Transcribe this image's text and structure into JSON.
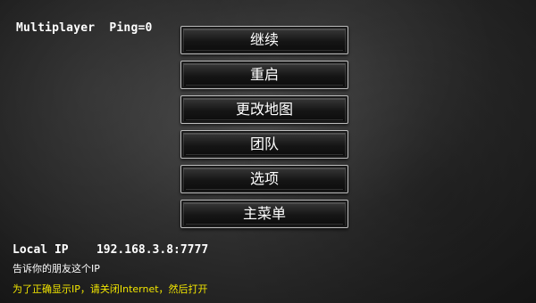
{
  "status": {
    "mode": "Multiplayer",
    "ping": "Ping=0"
  },
  "menu": {
    "items": [
      {
        "label": "继续"
      },
      {
        "label": "重启"
      },
      {
        "label": "更改地图"
      },
      {
        "label": "团队"
      },
      {
        "label": "选项"
      },
      {
        "label": "主菜单"
      }
    ]
  },
  "network": {
    "local_ip_label": "Local IP",
    "local_ip_value": "192.168.3.8:7777",
    "share_hint": "告诉你的朋友这个IP",
    "warning": "为了正确显示IP，请关闭Internet，然后打开"
  },
  "colors": {
    "warning_text": "#f2e600",
    "button_border": "#bdbdbd"
  }
}
